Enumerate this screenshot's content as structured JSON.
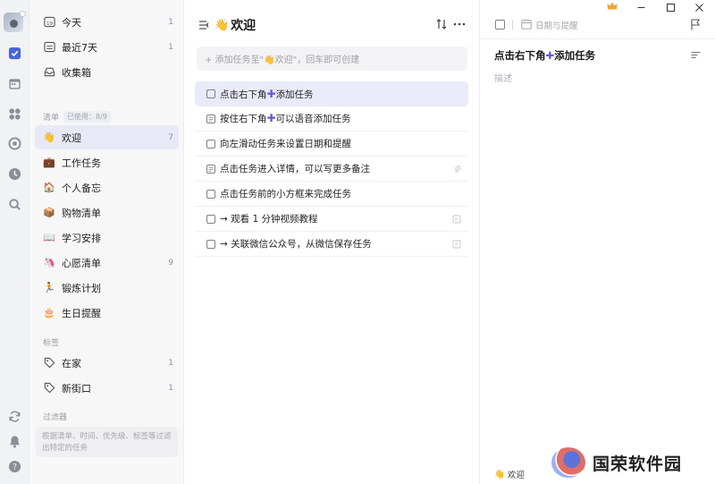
{
  "window": {
    "controls": [
      "minimize",
      "maximize",
      "close"
    ]
  },
  "rail": {
    "icons": [
      "avatar",
      "task-icon",
      "calendar-icon",
      "grid-icon",
      "target-icon",
      "clock-icon",
      "search-icon",
      "sync-icon",
      "bell-icon",
      "help-icon"
    ]
  },
  "sidebar": {
    "smart_lists": [
      {
        "label": "今天",
        "count": "1"
      },
      {
        "label": "最近7天",
        "count": "1"
      },
      {
        "label": "收集箱",
        "count": ""
      }
    ],
    "lists_section": {
      "title": "清单",
      "badge": "已使用：8/9"
    },
    "lists": [
      {
        "emoji": "👋",
        "label": "欢迎",
        "count": "7"
      },
      {
        "emoji": "💼",
        "label": "工作任务",
        "count": ""
      },
      {
        "emoji": "🏠",
        "label": "个人备忘",
        "count": ""
      },
      {
        "emoji": "📦",
        "label": "购物清单",
        "count": ""
      },
      {
        "emoji": "📖",
        "label": "学习安排",
        "count": ""
      },
      {
        "emoji": "🦄",
        "label": "心愿清单",
        "count": "9"
      },
      {
        "emoji": "🏃",
        "label": "锻炼计划",
        "count": ""
      },
      {
        "emoji": "🎂",
        "label": "生日提醒",
        "count": ""
      }
    ],
    "tags_section": {
      "title": "标签"
    },
    "tags": [
      {
        "label": "在家",
        "count": "1"
      },
      {
        "label": "新街口",
        "count": "1"
      }
    ],
    "filters_section": {
      "title": "过滤器"
    },
    "filter_hint": "根据清单、时间、优先级、标签等过滤出特定的任务"
  },
  "main": {
    "emoji": "👋",
    "title": "欢迎",
    "add_placeholder": "+ 添加任务至\"👋欢迎\"，回车即可创建",
    "tasks": [
      {
        "before": "点击右下角",
        "plus": "✚",
        "after": "添加任务",
        "kind": "checkbox"
      },
      {
        "before": "按住右下角",
        "plus": "✚",
        "after": "可以语音添加任务",
        "kind": "note"
      },
      {
        "before": "向左滑动任务来设置日期和提醒",
        "plus": "",
        "after": "",
        "kind": "checkbox"
      },
      {
        "before": "点击任务进入详情，可以写更多备注",
        "plus": "",
        "after": "",
        "kind": "note"
      },
      {
        "before": "点击任务前的小方框来完成任务",
        "plus": "",
        "after": "",
        "kind": "checkbox"
      },
      {
        "before": "→ 观看 1 分钟视频教程",
        "plus": "",
        "after": "",
        "kind": "checkbox"
      },
      {
        "before": "→ 关联微信公众号，从微信保存任务",
        "plus": "",
        "after": "",
        "kind": "checkbox"
      }
    ]
  },
  "detail": {
    "date_placeholder": "日期与提醒",
    "title_before": "点击右下角",
    "title_plus": "✚",
    "title_after": "添加任务",
    "description_placeholder": "描述",
    "list_emoji": "👋",
    "list_name": "欢迎"
  },
  "watermark": {
    "text": "国荣软件园"
  },
  "colors": {
    "accent": "#6a56d1",
    "selection": "#e9ecf8",
    "sidebar_bg": "#f7f7f8",
    "rail_bg": "#f1f2f4"
  }
}
